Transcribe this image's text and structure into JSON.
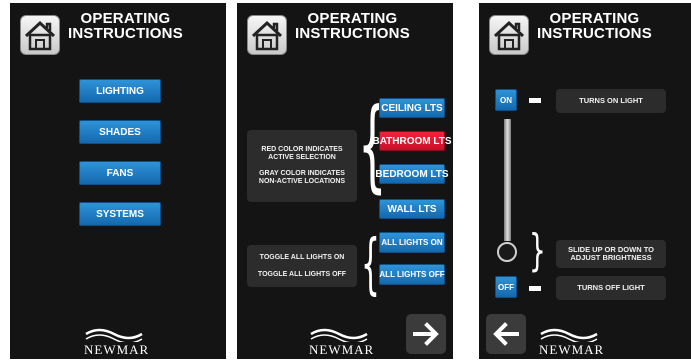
{
  "title": {
    "line1": "OPERATING",
    "line2": "INSTRUCTIONS"
  },
  "brand": "NEWMAR",
  "panel1": {
    "menu": [
      "LIGHTING",
      "SHADES",
      "FANS",
      "SYSTEMS"
    ]
  },
  "panel2": {
    "rooms": [
      "CEILING LTS",
      "BATHROOM LTS",
      "BEDROOM LTS",
      "WALL LTS"
    ],
    "active_room": "BATHROOM LTS",
    "info": {
      "red_line1": "RED COLOR INDICATES",
      "red_line2": "ACTIVE SELECTION",
      "gray_line1": "GRAY COLOR INDICATES",
      "gray_line2": "NON-ACTIVE LOCATIONS"
    },
    "toggle_info": {
      "on": "TOGGLE ALL LIGHTS ON",
      "off": "TOGGLE ALL LIGHTS OFF"
    },
    "all_on": "ALL LIGHTS ON",
    "all_off": "ALL LIGHTS OFF",
    "next_icon": "arrow-right-icon"
  },
  "panel3": {
    "on_label": "ON",
    "off_label": "OFF",
    "turns_on": "TURNS ON LIGHT",
    "turns_off": "TURNS OFF LIGHT",
    "slide_line1": "SLIDE UP OR DOWN TO",
    "slide_line2": "ADJUST BRIGHTNESS",
    "back_icon": "arrow-left-icon"
  },
  "colors": {
    "accent_blue": "#1f7fc7",
    "active_red": "#e0192f",
    "panel_bg": "#141414",
    "info_bg": "#2c2c2c"
  }
}
